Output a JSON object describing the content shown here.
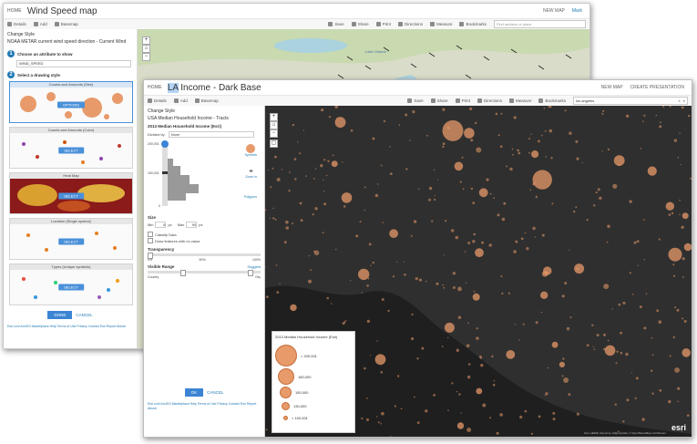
{
  "back_window": {
    "home": "HOME",
    "title": "Wind Speed map",
    "new_map": "NEW MAP",
    "user": "Mark",
    "toolbar": {
      "details": "Details",
      "add": "Add",
      "basemap": "Basemap",
      "save": "Save",
      "share": "Share",
      "print": "Print",
      "directions": "Directions",
      "measure": "Measure",
      "bookmarks": "Bookmarks",
      "search_placeholder": "Find address or place"
    },
    "sidebar": {
      "title": "Change Style",
      "layer": "NOAA METAR current wind speed direction - Current Wind",
      "step1_label": "Choose an attribute to show",
      "step1_value": "WIND_SPEED",
      "step2_label": "Select a drawing style",
      "cards": [
        {
          "title": "Counts and Amounts (Size)",
          "button": "OPTIONS"
        },
        {
          "title": "Counts and Amounts (Color)",
          "button": "SELECT"
        },
        {
          "title": "Heat Map",
          "button": "SELECT"
        },
        {
          "title": "Location (Single symbol)",
          "button": "SELECT"
        },
        {
          "title": "Types (Unique symbols)",
          "button": "SELECT"
        }
      ],
      "done": "DONE",
      "cancel": "CANCEL",
      "footer": "Esri.com   ArcGIS Marketplace   Help   Terms of Use   Privacy   Contact Esri   Report Abuse"
    },
    "map_labels": [
      "Lake Ontario"
    ]
  },
  "front_window": {
    "home": "HOME",
    "title_prefix": "LA",
    "title": "Income - Dark Base",
    "new_map": "NEW MAP",
    "create_presentation": "CREATE PRESENTATION",
    "toolbar": {
      "details": "Details",
      "add": "Add",
      "basemap": "Basemap",
      "save": "Save",
      "share": "Share",
      "print": "Print",
      "directions": "Directions",
      "measure": "Measure",
      "bookmarks": "Bookmarks",
      "search_value": "los angeles"
    },
    "sidebar": {
      "title": "Change Style",
      "layer": "USA Median Household Income - Tracts",
      "field": "2013 Median Household Income (Esri)",
      "divided_by_label": "Divided by",
      "divided_by_value": "None",
      "hist_max": "200,001",
      "hist_mid": "100,001",
      "hist_zero": "0",
      "symbols": "Symbols",
      "zoom_in": "Zoom in",
      "polygons": "Polygons",
      "size_label": "Size",
      "min_label": "Min",
      "min_value": "8",
      "px1": "px",
      "max_label": "Max",
      "max_value": "90",
      "px2": "px",
      "classify": "Classify Data",
      "draw_no_value": "Draw features with no value.",
      "transparency": "Transparency",
      "t0": "0%",
      "t50": "50%",
      "t100": "100%",
      "visible_range": "Visible Range",
      "suggest": "Suggest",
      "range_left": "Country",
      "range_right": "City",
      "ok": "OK",
      "cancel": "CANCEL",
      "footer": "Esri.com   ArcGIS Marketplace   Help   Terms of Use   Privacy   Contact Esri   Report Abuse"
    },
    "legend": {
      "title": "2013 Median Household Income (Esri)",
      "rows": [
        "> 200,001",
        "180,000",
        "150,000",
        "130,000",
        "< 100,001"
      ]
    },
    "attribution": "Esri, HERE, DeLorme, MapmyIndia, © OpenStreetMap contributors",
    "logo": "esri"
  },
  "colors": {
    "accent": "#1f78b4",
    "symbol": "#e89a6a",
    "dark_map": "#2f2f2f"
  }
}
